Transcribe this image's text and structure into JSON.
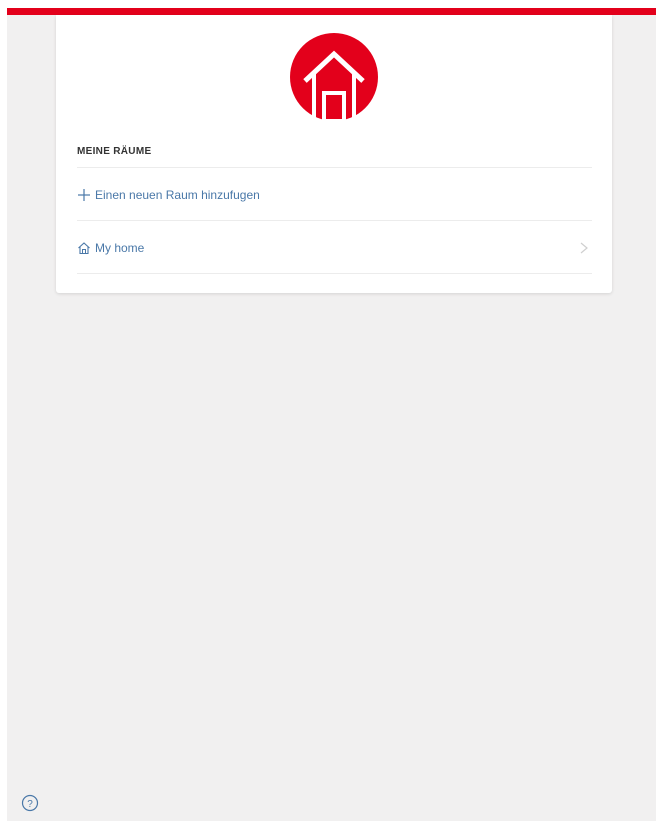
{
  "colors": {
    "brand": "#e3001b",
    "link": "#4a78a8",
    "background": "#f1f0f0",
    "card": "#ffffff"
  },
  "logo": {
    "icon": "house-icon"
  },
  "rooms": {
    "section_title": "MEINE RÄUME",
    "add_room_label": "Einen neuen Raum hinzufugen",
    "add_room_icon": "plus-icon",
    "items": [
      {
        "label": "My home",
        "icon": "house-outline-icon",
        "action_icon": "chevron-right-icon"
      }
    ]
  },
  "footer": {
    "help_icon": "help-circle-icon"
  }
}
